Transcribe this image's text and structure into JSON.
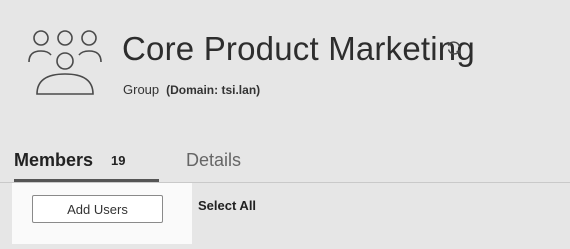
{
  "header": {
    "title": "Core Product Marketing",
    "type_label": "Group",
    "domain_label": "(Domain: tsi.lan)",
    "icon": "group-icon",
    "refresh_icon": "refresh-icon"
  },
  "tabs": [
    {
      "label": "Members",
      "count": "19",
      "active": true
    },
    {
      "label": "Details",
      "active": false
    }
  ],
  "actions": {
    "add_users_label": "Add Users",
    "select_all_label": "Select All"
  },
  "colors": {
    "page_background": "#e6e6e6",
    "action_bar_background": "#fafafa",
    "active_tab_underline": "#555555"
  }
}
